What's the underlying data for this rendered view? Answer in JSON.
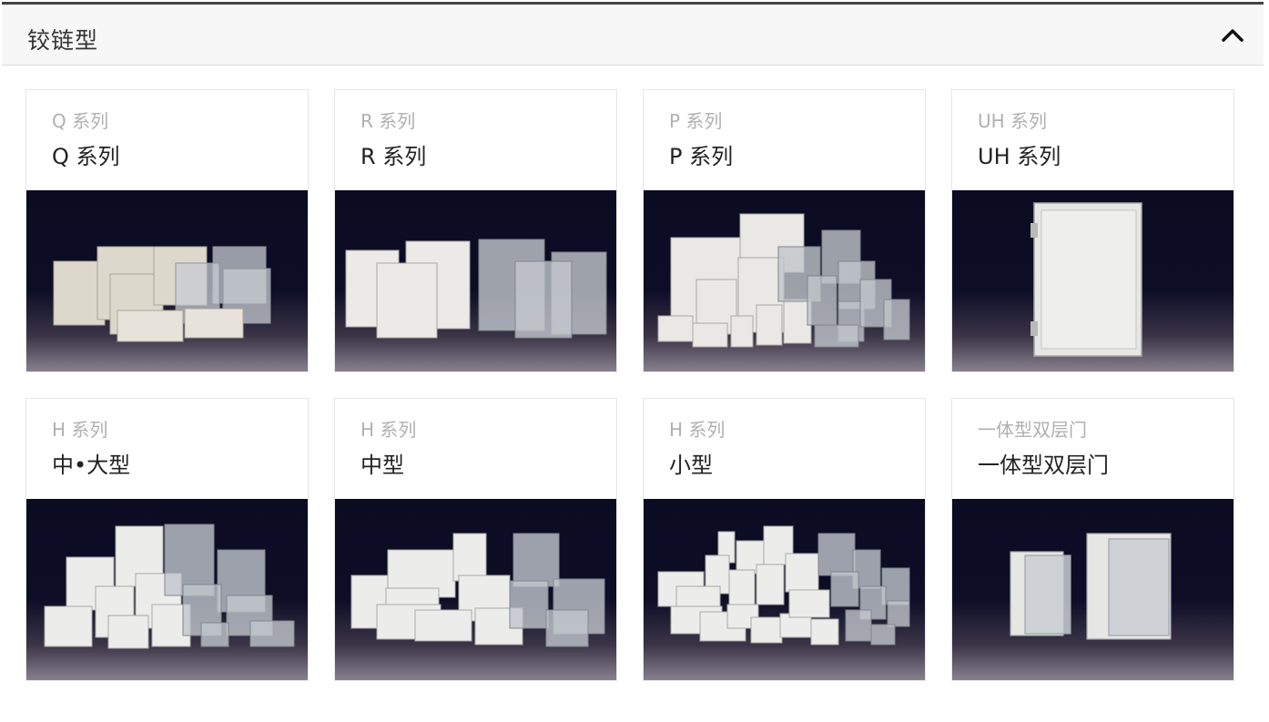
{
  "section": {
    "title": "铰链型",
    "collapse_icon": "chevron-up-icon"
  },
  "cards": [
    {
      "sub": "Q 系列",
      "name": "Q 系列"
    },
    {
      "sub": "R 系列",
      "name": "R 系列"
    },
    {
      "sub": "P 系列",
      "name": "P 系列"
    },
    {
      "sub": "UH 系列",
      "name": "UH 系列"
    },
    {
      "sub": "H 系列",
      "name": "中•大型"
    },
    {
      "sub": "H 系列",
      "name": "中型"
    },
    {
      "sub": "H 系列",
      "name": "小型"
    },
    {
      "sub": "一体型双层门",
      "name": "一体型双层门"
    }
  ],
  "colors": {
    "header_bg": "#f7f7f7",
    "header_border": "#444444",
    "image_bg": "#0b0b22",
    "enclosure_white": "#e8e8e6",
    "enclosure_clear": "#b8bcc0"
  }
}
